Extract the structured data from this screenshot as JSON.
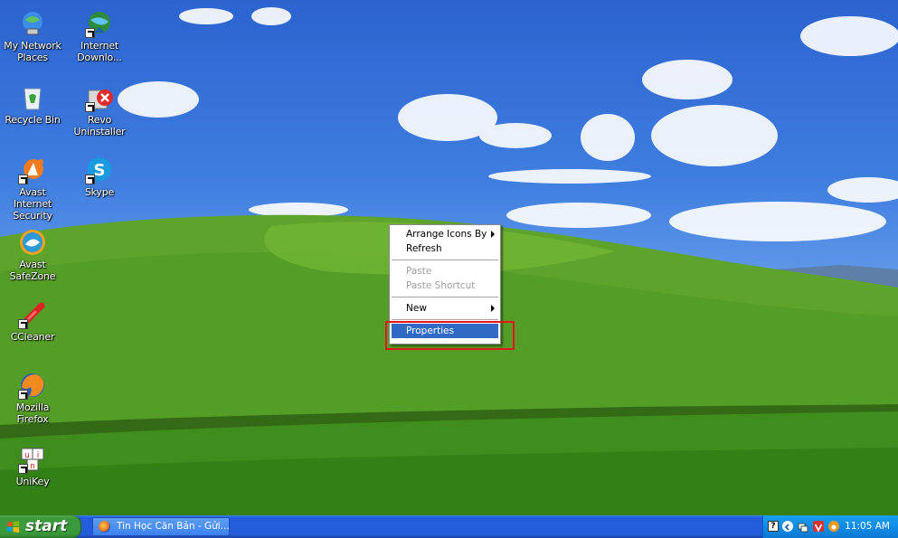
{
  "desktop": {
    "icons": [
      {
        "label": "My Network Places",
        "icon": "network-places-icon"
      },
      {
        "label": "Internet Downlo...",
        "icon": "internet-download-icon"
      },
      {
        "label": "Recycle Bin",
        "icon": "recycle-bin-icon"
      },
      {
        "label": "Revo Uninstaller",
        "icon": "revo-uninstaller-icon"
      },
      {
        "label": "Avast Internet Security",
        "icon": "avast-icon"
      },
      {
        "label": "Skype",
        "icon": "skype-icon"
      },
      {
        "label": "Avast SafeZone",
        "icon": "avast-safezone-icon"
      },
      {
        "label": "CCleaner",
        "icon": "ccleaner-icon"
      },
      {
        "label": "Mozilla Firefox",
        "icon": "firefox-icon"
      },
      {
        "label": "UniKey",
        "icon": "unikey-icon"
      }
    ]
  },
  "context_menu": {
    "items": [
      {
        "label": "Arrange Icons By",
        "submenu": true,
        "enabled": true
      },
      {
        "label": "Refresh",
        "submenu": false,
        "enabled": true
      },
      {
        "label": "Paste",
        "submenu": false,
        "enabled": false
      },
      {
        "label": "Paste Shortcut",
        "submenu": false,
        "enabled": false
      },
      {
        "label": "New",
        "submenu": true,
        "enabled": true
      },
      {
        "label": "Properties",
        "submenu": false,
        "enabled": true,
        "selected": true
      }
    ],
    "highlight_color": "#e5161b",
    "selection_color": "#316ac5"
  },
  "taskbar": {
    "start_label": "start",
    "tasks": [
      {
        "label": "Tin Học Căn Bản - Gửi...",
        "icon": "firefox-icon"
      }
    ],
    "tray_icons": [
      "help-icon",
      "chevron-left-icon",
      "network-icon",
      "vivaldi-icon",
      "avast-tray-icon"
    ],
    "clock": "11:05 AM"
  }
}
